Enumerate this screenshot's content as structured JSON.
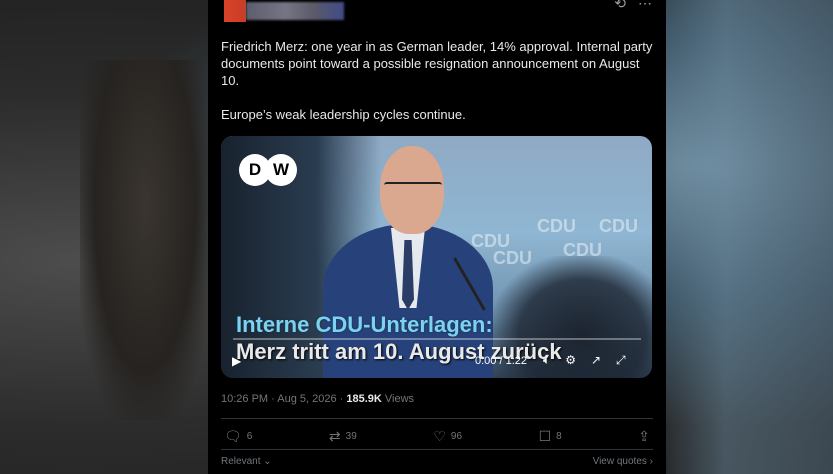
{
  "tweet": {
    "text_paragraphs": [
      "Friedrich Merz: one year in as German leader, 14% approval. Internal party documents point toward a possible resignation announcement on August 10.",
      "Europe’s weak leadership cycles continue."
    ],
    "video": {
      "logo": "DW",
      "caption_line1": "Interne CDU-Unterlagen:",
      "caption_line2": "Merz tritt am 10. August zurück",
      "time": "0:00 / 1:22",
      "backdrop_words": [
        "CDU",
        "CDU",
        "CDU",
        "CDU",
        "CDU"
      ]
    },
    "timestamp": "10:26 PM · Aug 5, 2026 · ",
    "views_count": "185.9K",
    "views_label": " Views",
    "actions": {
      "replies": "6",
      "reposts": "39",
      "likes": "96",
      "bookmarks": "8"
    },
    "footer": {
      "relevant": "Relevant",
      "quotes": "View quotes"
    }
  },
  "icons": {
    "top": [
      "grok-icon",
      "more-icon"
    ],
    "video_controls": [
      "play-icon",
      "volume-icon",
      "settings-icon",
      "popout-icon",
      "fullscreen-icon"
    ],
    "actions": [
      "reply-icon",
      "repost-icon",
      "like-icon",
      "bookmark-icon",
      "share-icon"
    ]
  }
}
